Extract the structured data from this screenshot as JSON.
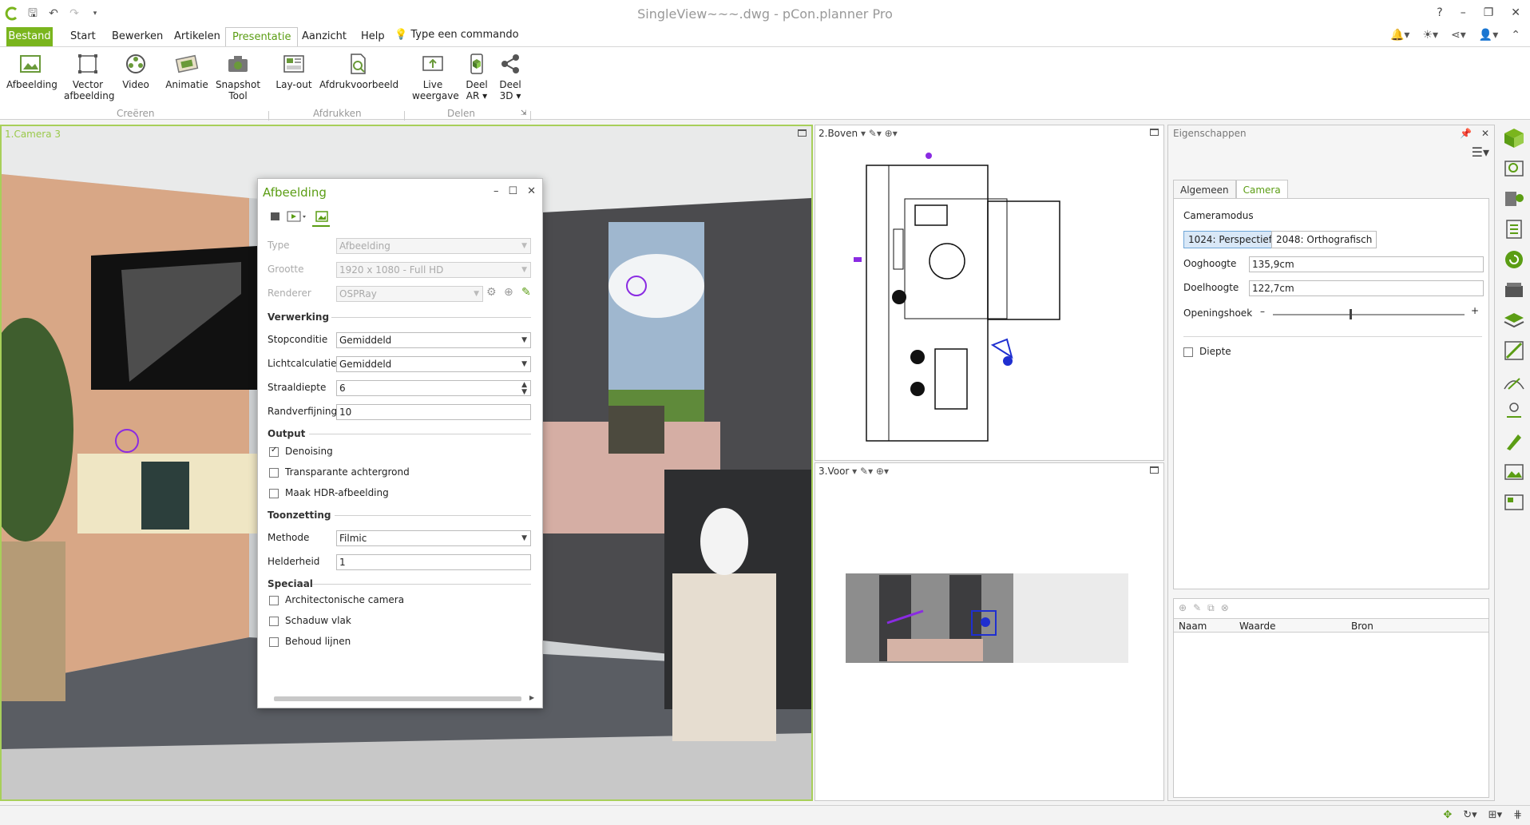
{
  "window": {
    "title": "SingleView~~~.dwg - pCon.planner Pro",
    "controls": [
      "?",
      "–",
      "❐",
      "✕"
    ]
  },
  "menu": {
    "file": "Bestand",
    "tabs": [
      "Start",
      "Bewerken",
      "Artikelen",
      "Presentatie",
      "Aanzicht",
      "Help"
    ],
    "command": "Type een commando"
  },
  "ribbon": {
    "buttons": {
      "afbeelding": "Afbeelding",
      "vector1": "Vector",
      "vector2": "afbeelding",
      "video": "Video",
      "animatie": "Animatie",
      "snapshot1": "Snapshot",
      "snapshot2": "Tool",
      "layout": "Lay-out",
      "afdrukvoorbeeld": "Afdrukvoorbeeld",
      "live1": "Live",
      "live2": "weergave",
      "deelar1": "Deel",
      "deelar2": "AR ▾",
      "deel3d1": "Deel",
      "deel3d2": "3D ▾"
    },
    "groups": {
      "creeren": "Creëren",
      "afdrukken": "Afdrukken",
      "delen": "Delen"
    }
  },
  "viewports": {
    "camera": "1.Camera 3",
    "top": "2.Boven",
    "front": "3.Voor"
  },
  "dialog": {
    "title": "Afbeelding",
    "rows": {
      "type_label": "Type",
      "type_value": "Afbeelding",
      "size_label": "Grootte",
      "size_value": "1920 x 1080 - Full HD",
      "renderer_label": "Renderer",
      "renderer_value": "OSPRay"
    },
    "sections": {
      "verwerking": "Verwerking",
      "output": "Output",
      "toonzetting": "Toonzetting",
      "speciaal": "Speciaal"
    },
    "verwerking": {
      "stop_label": "Stopconditie",
      "stop_value": "Gemiddeld",
      "light_label": "Lichtcalculatie",
      "light_value": "Gemiddeld",
      "ray_label": "Straaldiepte",
      "ray_value": "6",
      "edge_label": "Randverfijning",
      "edge_value": "10"
    },
    "output": {
      "denoising": "Denoising",
      "transparent": "Transparante achtergrond",
      "hdr": "Maak HDR-afbeelding"
    },
    "toonzetting": {
      "method_label": "Methode",
      "method_value": "Filmic",
      "bright_label": "Helderheid",
      "bright_value": "1"
    },
    "speciaal": {
      "arch": "Architectonische camera",
      "shadow": "Schaduw vlak",
      "lines": "Behoud lijnen"
    }
  },
  "properties": {
    "title": "Eigenschappen",
    "tabs": [
      "Algemeen",
      "Camera"
    ],
    "camera_mode_label": "Cameramodus",
    "mode_perspective": "1024: Perspectief",
    "mode_ortho": "2048: Orthografisch",
    "eye_label": "Ooghoogte",
    "eye_value": "135,9cm",
    "target_label": "Doelhoogte",
    "target_value": "122,7cm",
    "fov_label": "Openingshoek",
    "depth_label": "Diepte",
    "grid_columns": [
      "Naam",
      "Waarde",
      "Bron"
    ]
  }
}
